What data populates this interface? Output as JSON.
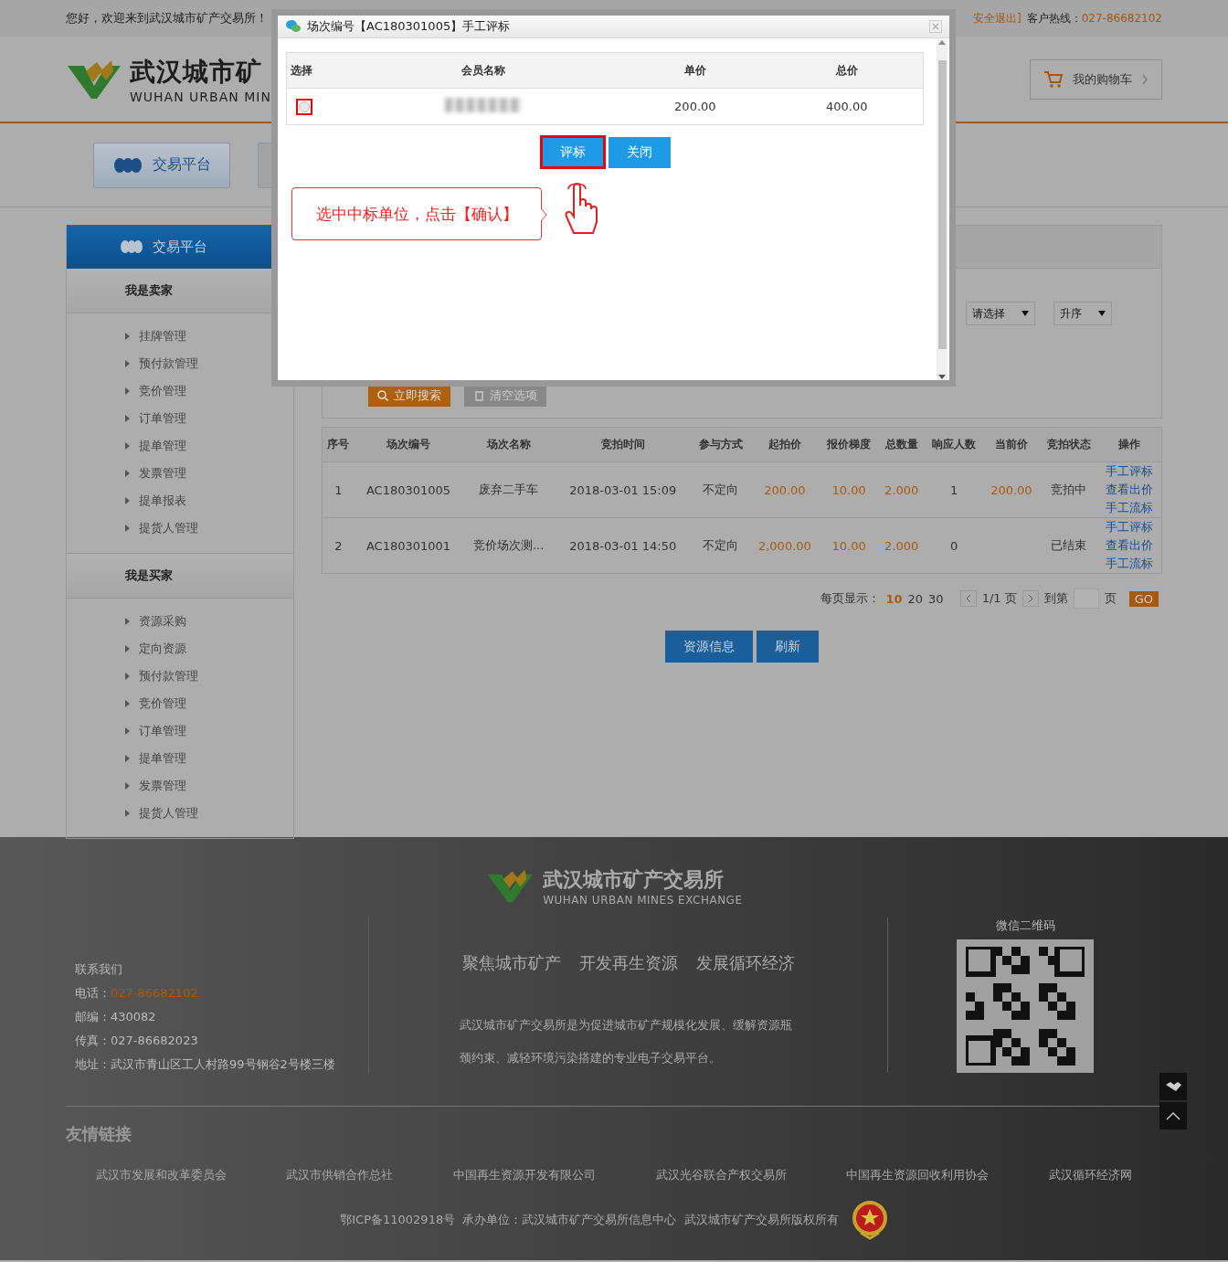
{
  "top_bar": {
    "greeting": "您好，欢迎来到武汉城市矿产交易所！",
    "logout": "安全退出]",
    "hotline_label": "客户热线：",
    "hotline": "027-86682102"
  },
  "header": {
    "logo_cn": "武汉城市矿",
    "logo_en": "WUHAN URBAN MIN",
    "cart": "我的购物车"
  },
  "nav_tabs": [
    {
      "label": "交易平台",
      "selected": true
    },
    {
      "selected": false
    }
  ],
  "sidebar": {
    "title": "交易平台",
    "sections": [
      {
        "heading": "我是卖家",
        "items": [
          "挂牌管理",
          "预付款管理",
          "竞价管理",
          "订单管理",
          "提单管理",
          "发票管理",
          "提单报表",
          "提货人管理"
        ]
      },
      {
        "heading": "我是买家",
        "items": [
          "资源采购",
          "定向资源",
          "预付款管理",
          "竞价管理",
          "订单管理",
          "提单管理",
          "发票管理",
          "提货人管理"
        ]
      }
    ]
  },
  "filters": {
    "sort_field": "请选择",
    "sort_order": "升序",
    "search_button": "立即搜索",
    "clear_button": "清空选项"
  },
  "table": {
    "columns": [
      "序号",
      "场次编号",
      "场次名称",
      "竞拍时间",
      "参与方式",
      "起拍价",
      "报价梯度",
      "总数量",
      "响应人数",
      "当前价",
      "竞拍状态",
      "操作"
    ],
    "rows": [
      {
        "no": "1",
        "code": "AC180301005",
        "name": "废弃二手车",
        "time": "2018-03-01 15:09",
        "mode": "不定向",
        "start_price": "200.00",
        "step": "10.00",
        "quantity": "2.000",
        "responders": "1",
        "current_price": "200.00",
        "status": "竞拍中",
        "actions": [
          "手工评标",
          "查看出价",
          "手工流标"
        ]
      },
      {
        "no": "2",
        "code": "AC180301001",
        "name": "竞价场次测...",
        "time": "2018-03-01 14:50",
        "mode": "不定向",
        "start_price": "2,000.00",
        "step": "10.00",
        "quantity": "2.000",
        "responders": "0",
        "status": "已结束",
        "actions": [
          "手工评标",
          "查看出价",
          "手工流标"
        ]
      }
    ]
  },
  "pagination": {
    "per_page_label": "每页显示：",
    "sizes": [
      {
        "label": "10",
        "selected": true
      },
      {
        "label": "20",
        "selected": false
      },
      {
        "label": "30",
        "selected": false
      }
    ],
    "page_info": "1/1 页",
    "goto_label": "到第",
    "page_unit": "页",
    "go_button": "GO"
  },
  "actions": [
    "资源信息",
    "刷新"
  ],
  "dialog": {
    "title": "场次编号【AC180301005】手工评标",
    "columns": [
      "选择",
      "会员名称",
      "单价",
      "总价"
    ],
    "rows": [
      {
        "selected": false,
        "unit_price": "200.00",
        "total_price": "400.00"
      }
    ],
    "buttons": [
      "评标",
      "关闭"
    ],
    "callout": "选中中标单位，点击【确认】"
  },
  "footer": {
    "logo_cn": "武汉城市矿产交易所",
    "logo_en": "WUHAN URBAN MINES EXCHANGE",
    "contact_heading": "联系我们",
    "contacts": [
      {
        "label": "电话：",
        "value": "027-86682102",
        "highlight": true
      },
      {
        "label": "邮编：",
        "value": "430082",
        "highlight": false
      },
      {
        "label": "传真：",
        "value": "027-86682023",
        "highlight": false
      },
      {
        "label": "地址：",
        "value": "武汉市青山区工人村路99号钢谷2号楼三楼",
        "highlight": false
      }
    ],
    "slogans": [
      "聚焦城市矿产",
      "开发再生资源",
      "发展循环经济"
    ],
    "description": "武汉城市矿产交易所是为促进城市矿产规模化发展、缓解资源瓶颈约束、减轻环境污染搭建的专业电子交易平台。",
    "qr_label": "微信二维码",
    "links_heading": "友情链接",
    "links": [
      "武汉市发展和改革委员会",
      "武汉市供销合作总社",
      "中国再生资源开发有限公司",
      "武汉光谷联合产权交易所",
      "中国再生资源回收利用协会",
      "武汉循环经济网"
    ],
    "copyright": "鄂ICP备11002918号  承办单位：武汉城市矿产交易所信息中心  武汉城市矿产交易所版权所有"
  }
}
